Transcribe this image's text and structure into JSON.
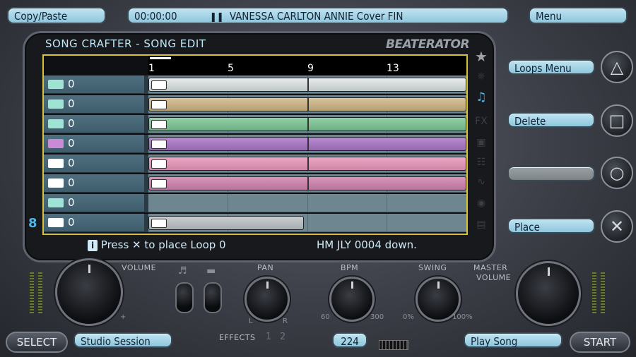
{
  "top": {
    "copy_paste": "Copy/Paste",
    "time": "00:00:00",
    "song_title": "VANESSA CARLTON ANNIE Cover FIN",
    "menu": "Menu"
  },
  "panel": {
    "title": "SONG CRAFTER - SONG EDIT",
    "logo": "BEATERATOR",
    "bars": [
      "1",
      "5",
      "9",
      "13"
    ]
  },
  "tracks": [
    {
      "value": "0",
      "icon_color": "#9fe3d3",
      "clip_color": "#e9ecec",
      "clip_shadow": "#bfc6c8",
      "clip_width": 450
    },
    {
      "value": "0",
      "icon_color": "#9fe3d3",
      "clip_color": "#d8c39a",
      "clip_shadow": "#b59f74",
      "clip_width": 450
    },
    {
      "value": "0",
      "icon_color": "#9fe3d3",
      "clip_color": "#92d0a6",
      "clip_shadow": "#6fae84",
      "clip_width": 450
    },
    {
      "value": "0",
      "icon_color": "#c98ad6",
      "clip_color": "#b98ad2",
      "clip_shadow": "#9569ae",
      "clip_width": 450
    },
    {
      "value": "0",
      "icon_color": "#ffffff",
      "clip_color": "#eea6c5",
      "clip_shadow": "#cd86a5",
      "clip_width": 450
    },
    {
      "value": "0",
      "icon_color": "#ffffff",
      "clip_color": "#d994bc",
      "clip_shadow": "#b77499",
      "clip_width": 450
    },
    {
      "value": "0",
      "icon_color": "#9fe3d3",
      "clip_color": "",
      "clip_shadow": "",
      "clip_width": 0
    },
    {
      "value": "0",
      "icon_color": "#ffffff",
      "clip_color": "#c9cdd0",
      "clip_shadow": "#a7acb0",
      "clip_width": 220
    }
  ],
  "status": {
    "hint": "Press ✕ to place Loop 0",
    "info": "HM JLY 0004 down."
  },
  "right": {
    "loops_menu": "Loops Menu",
    "delete": "Delete",
    "blank": "",
    "place": "Place"
  },
  "controls": {
    "volume": "VOLUME",
    "pan": "PAN",
    "pan_l": "L",
    "pan_r": "R",
    "effects": "EFFECTS",
    "fx1": "1",
    "fx2": "2",
    "bpm": "BPM",
    "bpm_min": "60",
    "bpm_max": "300",
    "swing": "SWING",
    "swing_min": "0%",
    "swing_max": "100%",
    "master": "MASTER",
    "master2": "VOLUME",
    "plus": "+"
  },
  "bottom": {
    "select": "SELECT",
    "studio_session": "Studio Session",
    "bpm_value": "224",
    "play_song": "Play Song",
    "start": "START",
    "octave": "8"
  }
}
